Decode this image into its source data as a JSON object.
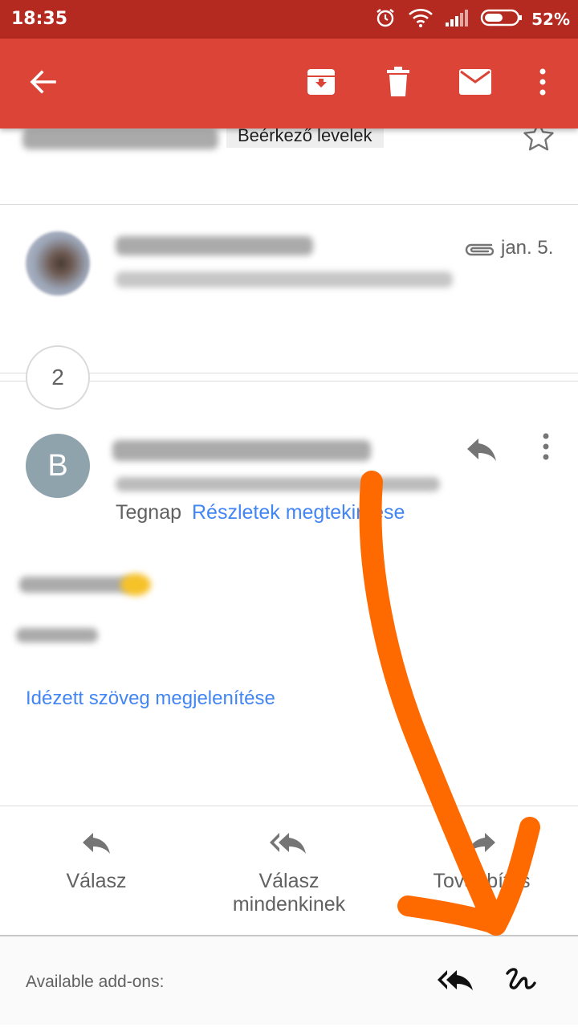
{
  "status_bar": {
    "time": "18:35",
    "battery_percent": "52%",
    "icons": [
      "alarm-icon",
      "wifi-icon",
      "signal-icon",
      "battery-icon"
    ]
  },
  "app_bar": {
    "color": "#db4437",
    "actions": [
      "back-arrow-icon",
      "archive-icon",
      "delete-icon",
      "mark-unread-icon",
      "more-vert-icon"
    ]
  },
  "header": {
    "label_chip": "Beérkező levelek"
  },
  "thread": {
    "first_message": {
      "date": "jan. 5.",
      "has_attachment": true
    },
    "collapsed_count": "2",
    "open_message": {
      "avatar_letter": "B",
      "avatar_color": "#8fa3ad",
      "time": "Tegnap",
      "details_link": "Részletek megtekintése",
      "quoted_link": "Idézett szöveg megjelenítése"
    }
  },
  "actions": {
    "reply": "Válasz",
    "reply_all_line1": "Válasz",
    "reply_all_line2": "mindenkinek",
    "forward": "Továbbítás"
  },
  "addons": {
    "label": "Available add-ons:"
  },
  "annotation": {
    "color": "#ff6a00",
    "type": "hand-drawn-arrow"
  }
}
